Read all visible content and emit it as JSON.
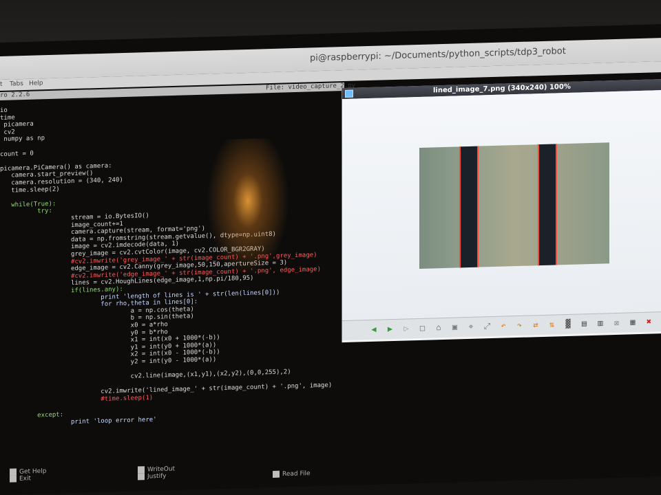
{
  "terminal": {
    "title": "pi@raspberrypi: ~/Documents/python_scripts/tdp3_robot",
    "menu": [
      "t",
      "Tabs",
      "Help"
    ],
    "nano_version": "ro 2.2.6",
    "file_label": "File: video_capture_2.py"
  },
  "code_lines": [
    "io",
    "time",
    " picamera",
    " cv2",
    " numpy as np",
    "",
    "count = 0",
    "",
    "picamera.PiCamera() as camera:",
    "   camera.start_preview()",
    "   camera.resolution = (340, 240)",
    "   time.sleep(2)",
    "",
    "   while(True):",
    "          try:",
    "                   stream = io.BytesIO()",
    "                   image_count+=1",
    "                   camera.capture(stream, format='png')",
    "                   data = np.fromstring(stream.getvalue(), dtype=np.uint8)",
    "                   image = cv2.imdecode(data, 1)",
    "                   grey_image = cv2.cvtColor(image, cv2.COLOR_BGR2GRAY)",
    "                   #cv2.imwrite('grey_image_' + str(image_count) + '.png',grey_image)",
    "                   edge_image = cv2.Canny(grey_image,50,150,apertureSize = 3)",
    "                   #cv2.imwrite('edge_image_' + str(image_count) + '.png', edge_image)",
    "                   lines = cv2.HoughLines(edge_image,1,np.pi/180,95)",
    "                   if(lines.any):",
    "                           print 'length of lines is ' + str(len(lines[0]))",
    "                           for rho,theta in lines[0]:",
    "                                   a = np.cos(theta)",
    "                                   b = np.sin(theta)",
    "                                   x0 = a*rho",
    "                                   y0 = b*rho",
    "                                   x1 = int(x0 + 1000*(-b))",
    "                                   y1 = int(y0 + 1000*(a))",
    "                                   x2 = int(x0 - 1000*(-b))",
    "                                   y2 = int(y0 - 1000*(a))",
    "",
    "                                   cv2.line(image,(x1,y1),(x2,y2),(0,0,255),2)",
    "",
    "                           cv2.imwrite('lined_image_' + str(image_count) + '.png', image)",
    "                           #time.sleep(1)",
    "",
    "          except:",
    "                   print 'loop error here'"
  ],
  "viewer": {
    "title": "lined_image_7.png (340x240) 100%"
  },
  "footer": {
    "get_help": "Get Help",
    "exit": "Exit",
    "write_out": "WriteOut",
    "justify": "Justify",
    "read_file": "Read File"
  },
  "colors": {
    "keyword": "#4fb0ff",
    "string": "#b7f08a",
    "comment": "#ff5a5a",
    "detected_line": "#ff4a3a"
  },
  "toolbar_icons": [
    "back-icon",
    "forward-icon",
    "play-icon",
    "rewind-icon",
    "home-icon",
    "fit-icon",
    "zoom-icon",
    "fullscreen-icon",
    "rotate-left-icon",
    "rotate-right-icon",
    "flip-horizontal-icon",
    "flip-vertical-icon",
    "histogram-icon",
    "save-icon",
    "save-as-icon",
    "delete-icon",
    "filmstrip-icon",
    "close-icon"
  ]
}
